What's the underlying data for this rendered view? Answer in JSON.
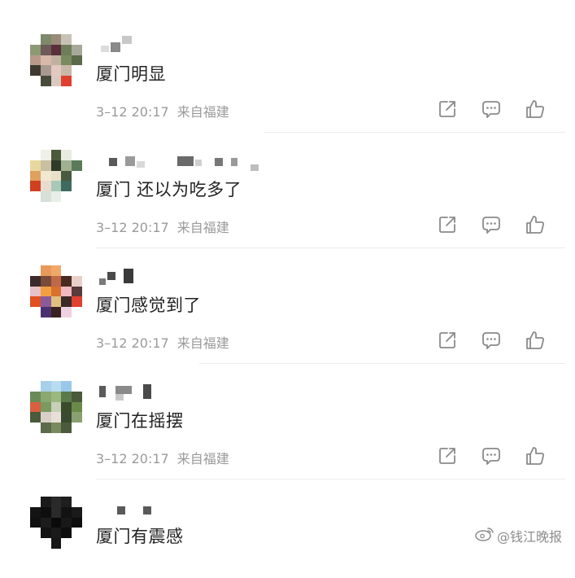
{
  "comments": [
    {
      "text": "厦门明显",
      "meta_time": "3–12 20:17",
      "meta_location": "来自福建",
      "avatar": "pixelated",
      "username": "pixelated"
    },
    {
      "text": "厦门 还以为吃多了",
      "meta_time": "3–12 20:17",
      "meta_location": "来自福建",
      "avatar": "pixelated",
      "username": "pixelated"
    },
    {
      "text": "厦门感觉到了",
      "meta_time": "3–12 20:17",
      "meta_location": "来自福建",
      "avatar": "pixelated",
      "username": "pixelated"
    },
    {
      "text": "厦门在摇摆",
      "meta_time": "3–12 20:17",
      "meta_location": "来自福建",
      "avatar": "pixelated",
      "username": "pixelated"
    },
    {
      "text": "厦门有震感",
      "avatar": "pixelated",
      "username": "pixelated"
    }
  ],
  "action_icons": [
    "share-icon",
    "comment-icon",
    "like-icon"
  ],
  "watermark": {
    "text": "@钱江晚报",
    "icon": "weibo-icon"
  },
  "colors": {
    "text": "#222222",
    "meta": "#9a9a9a",
    "divider": "#ececec",
    "icon": "#8a8a8a"
  }
}
